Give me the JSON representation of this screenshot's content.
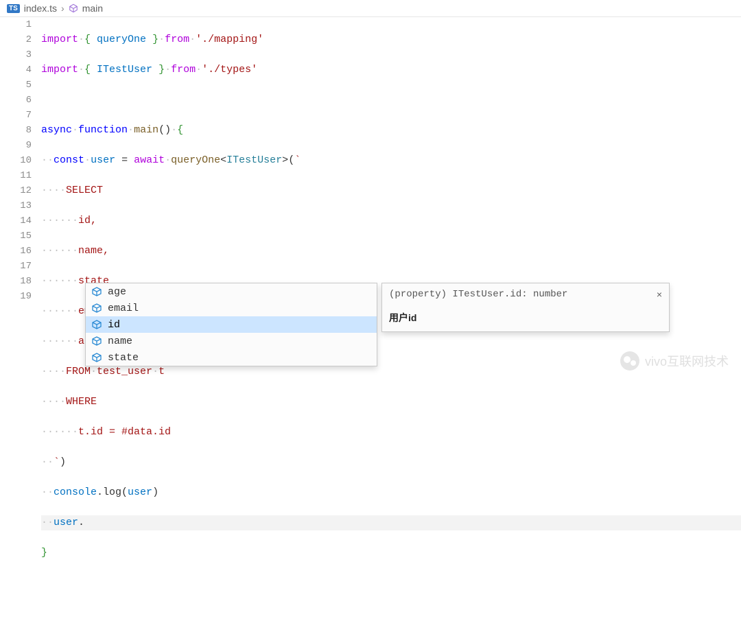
{
  "breadcrumb": {
    "badge": "TS",
    "file": "index.ts",
    "symbol": "main"
  },
  "gutter": [
    "1",
    "2",
    "3",
    "4",
    "5",
    "6",
    "7",
    "8",
    "9",
    "10",
    "11",
    "12",
    "13",
    "14",
    "15",
    "16",
    "17",
    "18",
    "19"
  ],
  "code": {
    "l1": {
      "kw": "import",
      "punc1": "{ ",
      "id": "queryOne",
      "punc2": " }",
      "from": "from",
      "str": "'./mapping'"
    },
    "l2": {
      "kw": "import",
      "punc1": "{ ",
      "id": "ITestUser",
      "punc2": " }",
      "from": "from",
      "str": "'./types'"
    },
    "l4": {
      "async": "async",
      "fnkw": "function",
      "fn": "main",
      "paren": "()",
      "brace": "{"
    },
    "l5": {
      "const": "const",
      "name": "user",
      "eq": " = ",
      "await": "await",
      "fn": "queryOne",
      "lt": "<",
      "type": "ITestUser",
      "gt": ">",
      "open": "(",
      "tick": "`"
    },
    "l6": "SELECT",
    "l7": "id,",
    "l8": "name,",
    "l9": "state",
    "l10": "email,",
    "l11": "age",
    "l12_a": "FROM",
    "l12_b": "test_user",
    "l12_c": "t",
    "l13": "WHERE",
    "l14": "t.id = #data.id",
    "l15_tick": "`",
    "l15_close": ")",
    "l16_a": "console",
    "l16_b": ".log(",
    "l16_c": "user",
    "l16_d": ")",
    "l17_a": "user",
    "l17_b": ".",
    "l18": "}"
  },
  "autocomplete": {
    "items": [
      {
        "label": "age"
      },
      {
        "label": "email"
      },
      {
        "label": "id"
      },
      {
        "label": "name"
      },
      {
        "label": "state"
      }
    ],
    "selected_index": 2
  },
  "tooltip": {
    "signature": "(property) ITestUser.id: number",
    "description": "用户id",
    "close": "×"
  },
  "watermark": {
    "text": "vivo互联网技术"
  }
}
